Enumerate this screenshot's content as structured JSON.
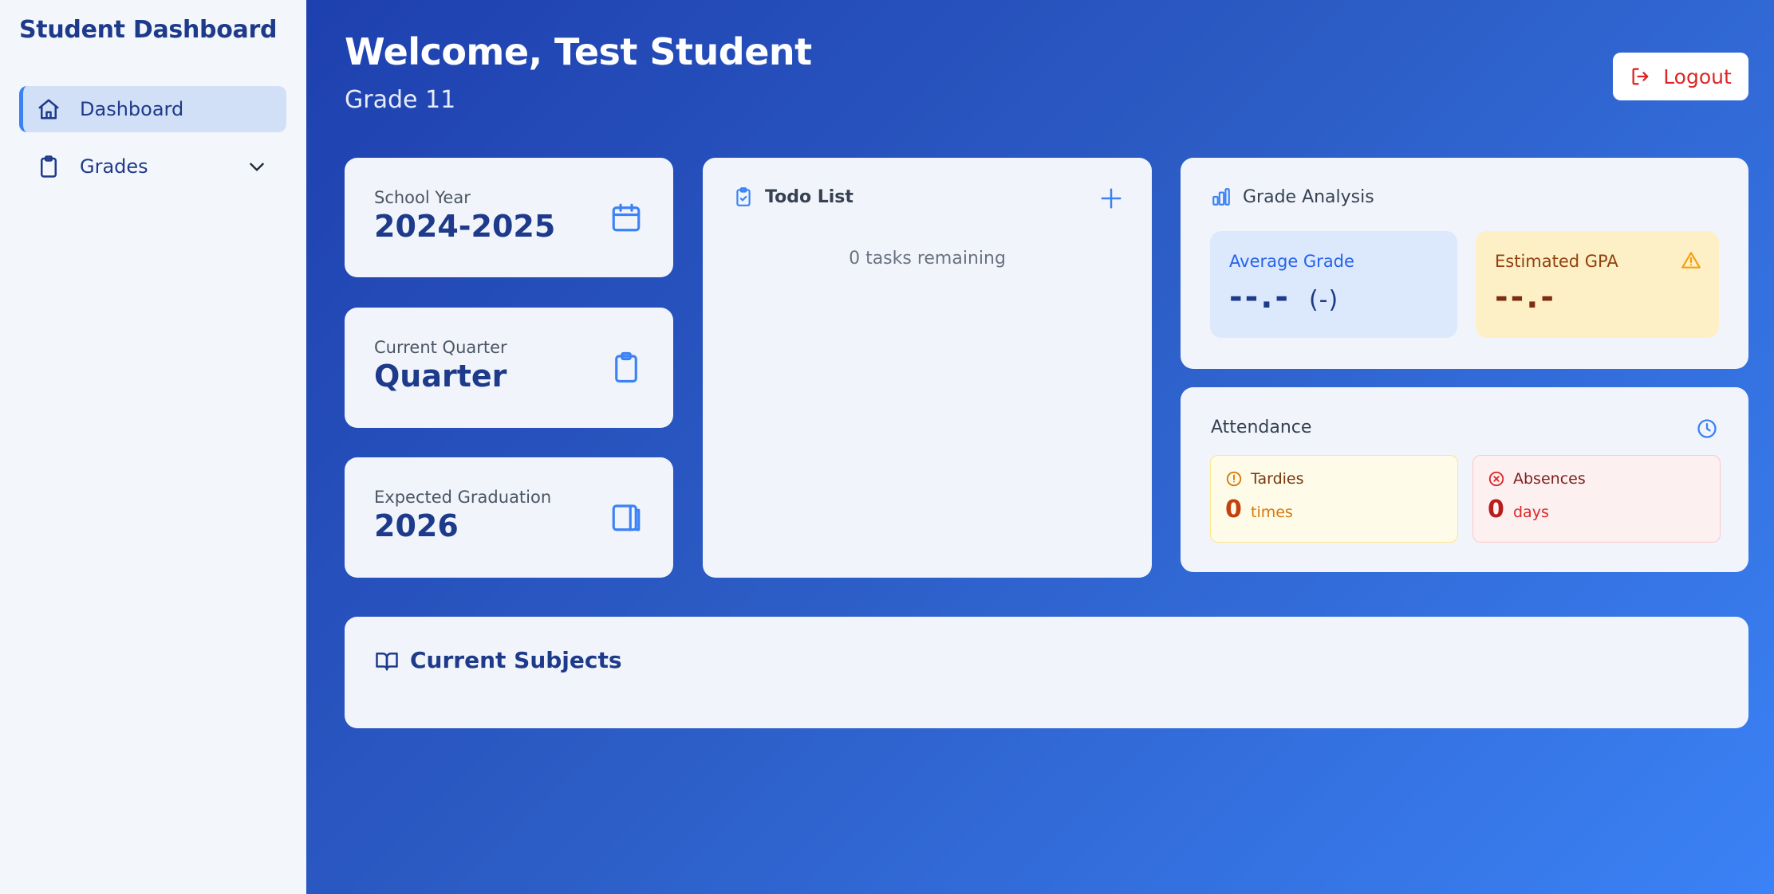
{
  "sidebar": {
    "brand": "Student Dashboard",
    "items": [
      {
        "label": "Dashboard",
        "icon": "home-icon"
      },
      {
        "label": "Grades",
        "icon": "clipboard-icon"
      }
    ]
  },
  "header": {
    "welcome": "Welcome, Test Student",
    "grade": "Grade 11",
    "logout_label": "Logout"
  },
  "stats": {
    "school_year": {
      "label": "School Year",
      "value": "2024-2025",
      "icon": "calendar-icon"
    },
    "current_quarter": {
      "label": "Current Quarter",
      "value": "Quarter",
      "icon": "clipboard-icon"
    },
    "graduation": {
      "label": "Expected Graduation",
      "value": "2026",
      "icon": "book-icon"
    }
  },
  "todo": {
    "title": "Todo List",
    "remaining": "0 tasks remaining"
  },
  "grade_analysis": {
    "title": "Grade Analysis",
    "average_label": "Average Grade",
    "average_value": "--.-",
    "average_suffix": "(-)",
    "gpa_label": "Estimated GPA",
    "gpa_value": "--.-"
  },
  "attendance": {
    "title": "Attendance",
    "tardies_label": "Tardies",
    "tardies_value": "0",
    "tardies_unit": "times",
    "absences_label": "Absences",
    "absences_value": "0",
    "absences_unit": "days"
  },
  "subjects": {
    "title": "Current Subjects"
  },
  "colors": {
    "brand": "#1e3a8a",
    "accent": "#3b82f6",
    "danger": "#dc2626",
    "warning": "#d97706"
  }
}
